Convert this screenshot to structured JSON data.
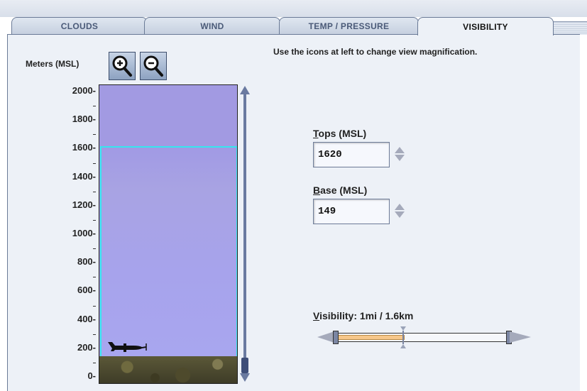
{
  "tabs": [
    {
      "label": "CLOUDS",
      "active": false
    },
    {
      "label": "WIND",
      "active": false
    },
    {
      "label": "TEMP / PRESSURE",
      "active": false
    },
    {
      "label": "VISIBILITY",
      "active": true
    }
  ],
  "hint": "Use the icons at left to change view magnification.",
  "units_label": "Meters (MSL)",
  "zoom_in_icon": "zoom-in-icon",
  "zoom_out_icon": "zoom-out-icon",
  "altitude_axis": {
    "ticks": [
      "2000-",
      "1800-",
      "1600-",
      "1400-",
      "1200-",
      "1000-",
      "800-",
      "600-",
      "400-",
      "200-",
      "0-"
    ],
    "range_m": [
      0,
      2000
    ]
  },
  "cloud_layer": {
    "top_m": 1620,
    "base_m": 149
  },
  "tops": {
    "label_accesskey": "T",
    "label_rest": "ops (MSL)",
    "value": "1620"
  },
  "base": {
    "label_accesskey": "B",
    "label_rest": "ase (MSL)",
    "value": "149"
  },
  "visibility": {
    "label_accesskey": "V",
    "label_rest": "isibility: 1mi / 1.6km",
    "slider_fraction": 0.39
  },
  "colors": {
    "cloud_border": "#35e6ee",
    "sky": "#a29ae2",
    "accent": "#6a7aa0"
  }
}
